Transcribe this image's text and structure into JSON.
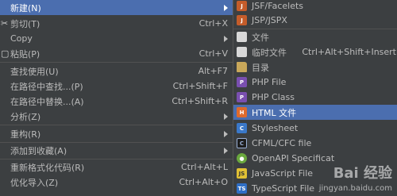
{
  "left_menu": {
    "items": [
      {
        "label": "新建(N)",
        "shortcut": "",
        "submenu": true,
        "selected": true
      },
      {
        "label": "剪切(T)",
        "shortcut": "Ctrl+X"
      },
      {
        "label": "Copy",
        "shortcut": "",
        "submenu": true
      },
      {
        "label": "粘贴(P)",
        "shortcut": "Ctrl+V"
      },
      {
        "label": "查找使用(U)",
        "shortcut": "Alt+F7"
      },
      {
        "label": "在路径中查找...(P)",
        "shortcut": "Ctrl+Shift+F"
      },
      {
        "label": "在路径中替换...(A)",
        "shortcut": "Ctrl+Shift+R"
      },
      {
        "label": "分析(Z)",
        "shortcut": "",
        "submenu": true
      },
      {
        "label": "重构(R)",
        "shortcut": "",
        "submenu": true
      },
      {
        "label": "添加到收藏(A)",
        "shortcut": "",
        "submenu": true
      },
      {
        "label": "重新格式化代码(R)",
        "shortcut": "Ctrl+Alt+L"
      },
      {
        "label": "优化导入(Z)",
        "shortcut": "Ctrl+Alt+O"
      }
    ],
    "icons": {
      "cut": "scissors-icon",
      "paste": "clipboard-icon"
    }
  },
  "right_menu": {
    "items": [
      {
        "label": "JSF/Facelets",
        "icon": "jsf-icon"
      },
      {
        "label": "JSP/JSPX",
        "icon": "jsp-icon"
      },
      {
        "label": "文件",
        "icon": "file-icon"
      },
      {
        "label": "临时文件",
        "shortcut": "Ctrl+Alt+Shift+Insert",
        "icon": "scratch-file-icon"
      },
      {
        "label": "目录",
        "icon": "folder-icon"
      },
      {
        "label": "PHP File",
        "icon": "php-file-icon"
      },
      {
        "label": "PHP Class",
        "icon": "php-class-icon"
      },
      {
        "label": "HTML 文件",
        "icon": "html-file-icon",
        "selected": true
      },
      {
        "label": "Stylesheet",
        "icon": "css-icon"
      },
      {
        "label": "CFML/CFC file",
        "icon": "cfml-icon"
      },
      {
        "label": "OpenAPI Specificat",
        "icon": "openapi-icon"
      },
      {
        "label": "JavaScript File",
        "icon": "js-icon"
      },
      {
        "label": "TypeScript File",
        "icon": "ts-icon"
      }
    ]
  },
  "watermark": {
    "brand": "Bai 经验",
    "url": "jingyan.baidu.com"
  },
  "colors": {
    "background": "#3c3f41",
    "selection": "#4b6eaf",
    "text": "#bbbbbb"
  }
}
